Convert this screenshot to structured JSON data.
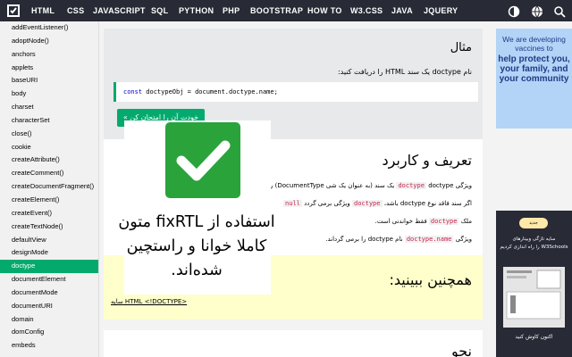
{
  "topnav": {
    "items": [
      "HTML",
      "CSS",
      "JAVASCRIPT",
      "SQL",
      "PYTHON",
      "PHP",
      "BOOTSTRAP",
      "HOW TO",
      "W3.CSS",
      "JAVA",
      "JQUERY"
    ],
    "icons": [
      "contrast-icon",
      "globe-icon",
      "search-icon"
    ]
  },
  "sidebar": {
    "items": [
      "addEventListener()",
      "adoptNode()",
      "anchors",
      "applets",
      "baseURI",
      "body",
      "charset",
      "characterSet",
      "close()",
      "cookie",
      "createAttribute()",
      "createComment()",
      "createDocumentFragment()",
      "createElement()",
      "createEvent()",
      "createTextNode()",
      "defaultView",
      "designMode",
      "doctype",
      "documentElement",
      "documentMode",
      "documentURI",
      "domain",
      "domConfig",
      "embeds"
    ],
    "active": "doctype"
  },
  "example": {
    "title": "مثال",
    "desc": "نام doctype یک سند HTML را دریافت کنید:",
    "code_kw": "const",
    "code_rest": " doctypeObj = document.doctype.name;",
    "try_button": "خودت آن را امتحان کن »"
  },
  "definition": {
    "title": "تعریف و کاربرد",
    "line1_a": "ویژگی ",
    "line1_code": "doctype",
    "line1_b": " doctype یک سند (به عنوان یک شی DocumentType) را برمی گرداند.",
    "line2_a": "اگر سند فاقد نوع doctype باشد، ",
    "line2_code": "doctype",
    "line2_b": " ویژگی برمی گردد ",
    "line2_code2": "null",
    "line3_a": "ملک ",
    "line3_code": "doctype",
    "line3_b": " فقط خواندنی است.",
    "line4_a": "ویژگی ",
    "line4_code": "doctype.name",
    "line4_b": " نام doctype را برمی گرداند."
  },
  "seealso": {
    "title": "همچنین ببینید:",
    "link": "سایه HTML <!DOCTYPE>"
  },
  "bottom": {
    "title": "نحو"
  },
  "ad1": {
    "line1": "We are developing vaccines to",
    "line2": "help protect you, your family, and your community"
  },
  "ad2": {
    "pill": "جدید",
    "text1": "سایه تازگی وبینارهای W3Schools را راه اندازی کردیم",
    "cta": "اکنون کاوش کنید"
  },
  "overlay": {
    "text": "استفاده از fixRTL متون کاملا خوانا و راستچین شده‌اند."
  },
  "colors": {
    "nav_bg": "#282a35",
    "accent": "#04aa6d",
    "code_red": "#c7254e",
    "seealso_bg": "#ffffcc",
    "check_green": "#2aa33b"
  }
}
